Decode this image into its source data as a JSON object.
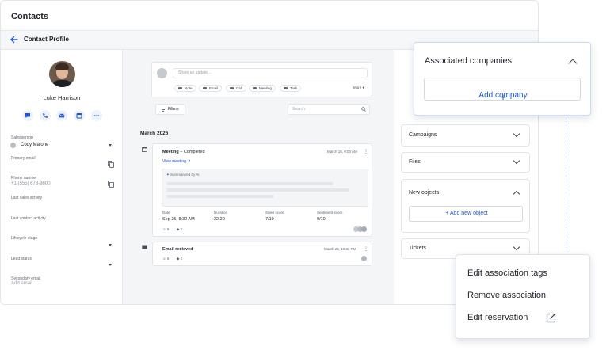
{
  "app": {
    "title": "Contacts"
  },
  "profile_bar": {
    "title": "Contact Profile"
  },
  "contact": {
    "name": "Luke Harrison"
  },
  "fields": {
    "salesperson_label": "Salesperson",
    "salesperson_value": "Cody Malone",
    "primary_email_label": "Primary email",
    "phone_label": "Phone number",
    "phone_value": "+1 (555) 678-9800",
    "last_sales_label": "Last sales activity",
    "last_contact_label": "Last contact activity",
    "lifecycle_label": "Lifecycle stage",
    "lead_status_label": "Lead status",
    "secondary_email_label": "Secondary email",
    "secondary_email_placeholder": "Add email"
  },
  "composer": {
    "placeholder": "Share an update...",
    "actions": [
      "Note",
      "Email",
      "Call",
      "Meeting",
      "Task"
    ],
    "more": "More"
  },
  "toolbar": {
    "filters": "Filters",
    "search_placeholder": "Search"
  },
  "timeline": {
    "month": "March 2026",
    "meeting": {
      "title": "Meeting",
      "status": "– Completed",
      "timestamp": "March 15, 9:00 AM",
      "link": "View meeting",
      "ai_label": "Summarized by AI",
      "col_date": "Date",
      "col_duration": "Duration",
      "col_sales": "Sales score",
      "col_sentiment": "Sentiment score",
      "val_date": "Sep 25, 8:30 AM",
      "val_duration": "22:20",
      "val_sales": "7/10",
      "val_sentiment": "9/10",
      "likes": "5",
      "tags": "2"
    },
    "email": {
      "title": "Email recieved",
      "timestamp": "March 25, 10:22 PM",
      "likes": "5",
      "tags": "2"
    }
  },
  "right_panel": {
    "associated_companies": {
      "title": "Associated companies",
      "add_label": "Add company"
    },
    "campaigns": "Campaigns",
    "files": "Files",
    "new_objects": {
      "title": "New objects",
      "add_label": "Add new object"
    },
    "tickets": "Tickets"
  },
  "context_menu": {
    "items": [
      "Edit association tags",
      "Remove association",
      "Edit reservation"
    ]
  },
  "colors": {
    "accent": "#1b57d2",
    "border": "#e1e4e8",
    "canvas": "#f4f5f6"
  }
}
